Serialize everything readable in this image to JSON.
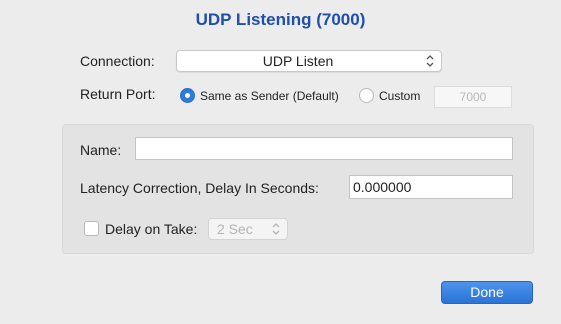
{
  "window": {
    "title": "UDP Listening (7000)"
  },
  "connection": {
    "label": "Connection:",
    "selected": "UDP Listen"
  },
  "return_port": {
    "label": "Return Port:",
    "options": [
      {
        "label": "Same as Sender (Default)",
        "selected": true
      },
      {
        "label": "Custom",
        "selected": false
      }
    ],
    "custom_placeholder": "7000"
  },
  "settings": {
    "name_label": "Name:",
    "name_value": "",
    "latency_label": "Latency Correction, Delay In Seconds:",
    "latency_value": "0.000000",
    "delay_on_take_label": "Delay on Take:",
    "delay_on_take_checked": false,
    "delay_on_take_value": "2 Sec"
  },
  "actions": {
    "done_label": "Done"
  },
  "colors": {
    "accent": "#2f7bd9",
    "title": "#1f4fa8",
    "background": "#ececec",
    "panel": "#e3e3e3"
  }
}
